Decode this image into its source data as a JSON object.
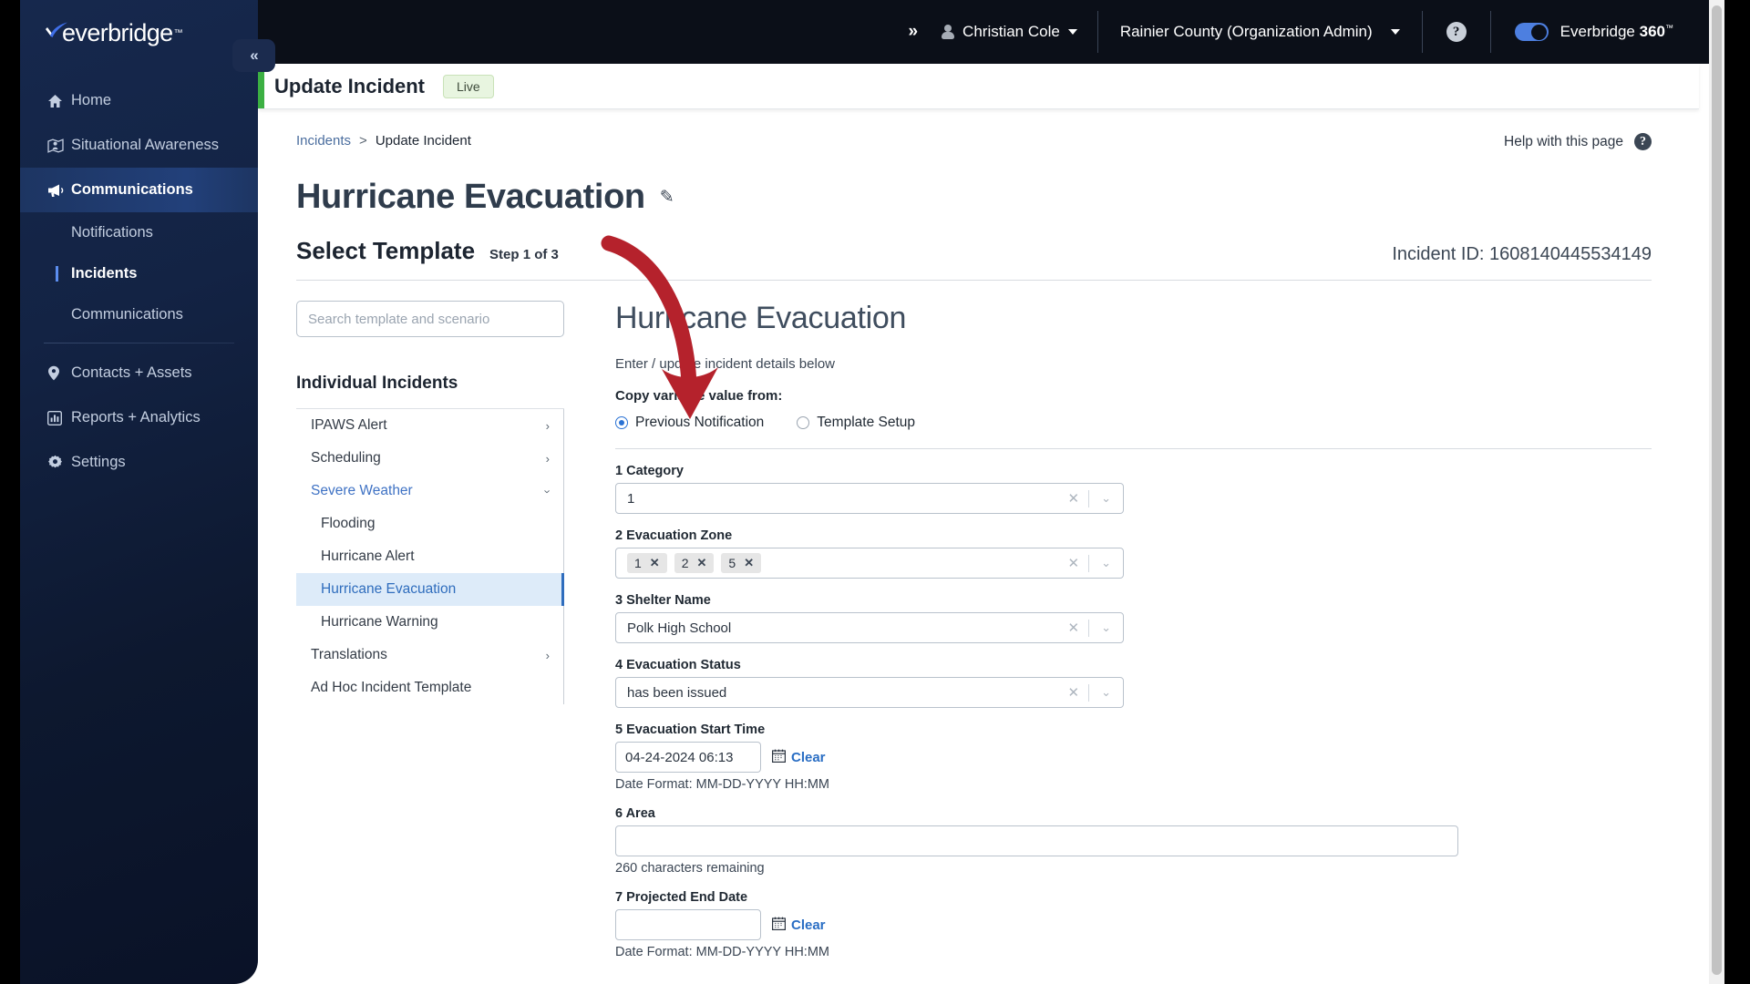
{
  "topbar": {
    "expand_chevron": "»",
    "user_name": "Christian Cole",
    "organization": "Rainier County (Organization Admin)",
    "help_icon_label": "?",
    "product_toggle": {
      "brand": "Everbridge",
      "suffix": "360",
      "trademark": "™",
      "enabled": true,
      "accent": "#4d7fe0"
    }
  },
  "sidebar": {
    "logo_text": "everbridge",
    "logo_tm": "™",
    "collapse_label": "«",
    "items": [
      {
        "label": "Home",
        "icon": "home-icon"
      },
      {
        "label": "Situational Awareness",
        "icon": "map-pin-person-icon"
      },
      {
        "label": "Communications",
        "icon": "megaphone-icon",
        "active": true
      },
      {
        "label": "Notifications",
        "icon": "",
        "sub": true
      },
      {
        "label": "Incidents",
        "icon": "",
        "sub": true,
        "current": true
      },
      {
        "label": "Communications",
        "icon": "",
        "sub": true
      },
      {
        "label": "Contacts + Assets",
        "icon": "location-pin-icon"
      },
      {
        "label": "Reports + Analytics",
        "icon": "bar-chart-icon"
      },
      {
        "label": "Settings",
        "icon": "gear-icon"
      }
    ]
  },
  "page": {
    "card_title": "Update Incident",
    "live_badge": "Live",
    "breadcrumb": {
      "parent": "Incidents",
      "separator": ">",
      "current": "Update Incident"
    },
    "help_with_page": "Help with this page",
    "incident_title": "Hurricane Evacuation",
    "edit_icon": "✎",
    "incident_id": "Incident ID: 1608140445534149",
    "step_heading": "Select Template",
    "step_indicator": "Step 1 of 3"
  },
  "templates": {
    "search_placeholder": "Search template and scenario",
    "search_value": "",
    "section_heading": "Individual Incidents",
    "items": [
      {
        "label": "IPAWS Alert",
        "type": "group",
        "state": "collapsed",
        "chevron": "›"
      },
      {
        "label": "Scheduling",
        "type": "group",
        "state": "collapsed",
        "chevron": "›"
      },
      {
        "label": "Severe Weather",
        "type": "group",
        "state": "expanded",
        "chevron": "›"
      },
      {
        "label": "Flooding",
        "type": "child"
      },
      {
        "label": "Hurricane Alert",
        "type": "child"
      },
      {
        "label": "Hurricane Evacuation",
        "type": "child",
        "selected": true
      },
      {
        "label": "Hurricane Warning",
        "type": "child"
      },
      {
        "label": "Translations",
        "type": "group",
        "state": "collapsed",
        "chevron": "›"
      },
      {
        "label": "Ad Hoc Incident Template",
        "type": "group"
      }
    ]
  },
  "form": {
    "title": "Hurricane Evacuation",
    "subtitle": "Enter / update incident details below",
    "copy_label": "Copy variable value from:",
    "radio_options": [
      {
        "label": "Previous Notification",
        "selected": true
      },
      {
        "label": "Template Setup",
        "selected": false
      }
    ],
    "fields": [
      {
        "number": "1",
        "label": "Category",
        "type": "select",
        "value": "1",
        "clear_icon": "✕",
        "chevron": "⌄"
      },
      {
        "number": "2",
        "label": "Evacuation Zone",
        "type": "multiselect",
        "chips": [
          "1",
          "2",
          "5"
        ],
        "chip_remove": "✕",
        "clear_icon": "✕",
        "chevron": "⌄"
      },
      {
        "number": "3",
        "label": "Shelter Name",
        "type": "select",
        "value": "Polk High School",
        "clear_icon": "✕",
        "chevron": "⌄"
      },
      {
        "number": "4",
        "label": "Evacuation Status",
        "type": "select",
        "value": "has been issued",
        "clear_icon": "✕",
        "chevron": "⌄"
      },
      {
        "number": "5",
        "label": "Evacuation Start Time",
        "type": "date",
        "value": "04-24-2024 06:13",
        "clear_link": "Clear",
        "hint": "Date Format: MM-DD-YYYY HH:MM"
      },
      {
        "number": "6",
        "label": "Area",
        "type": "textarea",
        "value": "",
        "hint": "260 characters remaining"
      },
      {
        "number": "7",
        "label": "Projected End Date",
        "type": "date",
        "value": "",
        "clear_link": "Clear",
        "hint": "Date Format: MM-DD-YYYY HH:MM"
      }
    ]
  },
  "annotation": {
    "type": "curved-arrow",
    "color": "#b5222c",
    "points_to": "Previous Notification"
  }
}
